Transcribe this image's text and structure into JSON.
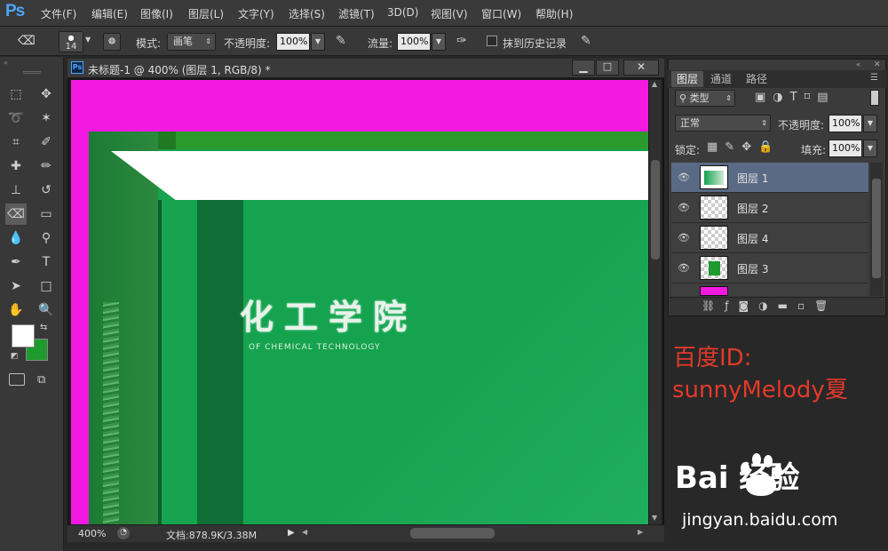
{
  "app": {
    "logo": "Ps"
  },
  "menu": [
    "文件(F)",
    "编辑(E)",
    "图像(I)",
    "图层(L)",
    "文字(Y)",
    "选择(S)",
    "滤镜(T)",
    "3D(D)",
    "视图(V)",
    "窗口(W)",
    "帮助(H)"
  ],
  "options": {
    "brush_size": "14",
    "mode_label": "模式:",
    "mode_value": "画笔",
    "opacity_label": "不透明度:",
    "opacity_value": "100%",
    "flow_label": "流量:",
    "flow_value": "100%",
    "history_label": "抹到历史记录"
  },
  "document": {
    "title": "未标题-1 @ 400% (图层 1, RGB/8) *",
    "zoom": "400%",
    "doc_size": "文档:878.9K/3.38M",
    "canvas_text": "化工学院",
    "canvas_subtext": "OF CHEMICAL TECHNOLOGY"
  },
  "colors": {
    "magenta": "#f319e0",
    "green": "#16a34f",
    "dark_green": "#0e6e35",
    "fg_swatch": "#ffffff",
    "bg_swatch": "#1f9a2f"
  },
  "layers_panel": {
    "tabs": [
      "图层",
      "通道",
      "路径"
    ],
    "filter_kind": "类型",
    "blend_mode": "正常",
    "opacity_label": "不透明度:",
    "opacity_value": "100%",
    "lock_label": "锁定:",
    "fill_label": "填充:",
    "fill_value": "100%",
    "layers": [
      {
        "name": "图层 1",
        "selected": true
      },
      {
        "name": "图层 2",
        "selected": false
      },
      {
        "name": "图层 4",
        "selected": false
      },
      {
        "name": "图层 3",
        "selected": false
      }
    ]
  },
  "watermark": {
    "line1": "百度ID:",
    "line2": "sunnyMelody夏",
    "logo": "Bai  经验",
    "url": "jingyan.baidu.com"
  }
}
